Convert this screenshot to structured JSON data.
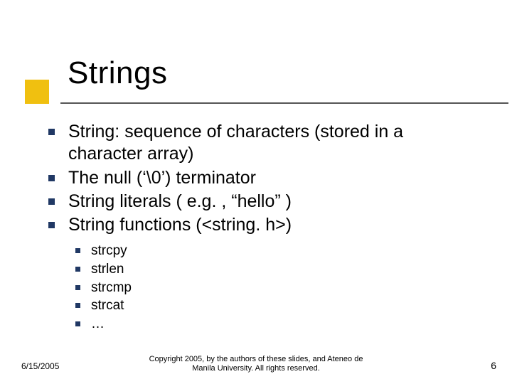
{
  "title": "Strings",
  "bullets": [
    "String: sequence of characters (stored in a character array)",
    "The null (‘\\0’) terminator",
    "String literals ( e.g. , “hello” )",
    "String functions (<string. h>)"
  ],
  "subbullets": [
    "strcpy",
    "strlen",
    "strcmp",
    "strcat",
    "…"
  ],
  "footer": {
    "date": "6/15/2005",
    "copyright_line1": "Copyright 2005, by the authors of these slides, and Ateneo de",
    "copyright_line2": "Manila University. All rights reserved.",
    "page": "6"
  }
}
